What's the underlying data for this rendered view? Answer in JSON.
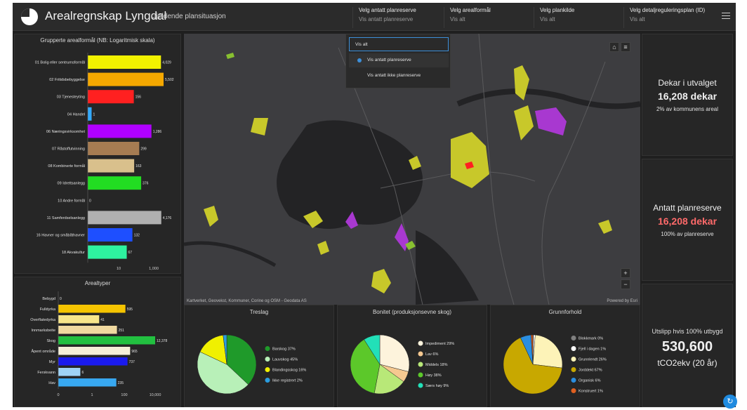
{
  "header": {
    "title": "Arealregnskap Lyngdal",
    "subtitle": "Gjeldende plansituasjon",
    "filters": [
      {
        "label": "Velg antatt planreserve",
        "value": "Vis antatt planreserve"
      },
      {
        "label": "Velg arealformål",
        "value": "Vis alt"
      },
      {
        "label": "Velg plankilde",
        "value": "Vis alt"
      },
      {
        "label": "Velg detaljreguleringsplan (ID)",
        "value": "Vis alt"
      }
    ]
  },
  "dropdown": {
    "options": [
      "Vis alt",
      "Vis antatt planreserve",
      "Vis antatt ikke planreserve"
    ]
  },
  "map": {
    "credit": "Kartverket, Geovekst, Kommuner, Corine og OSM - Geodata AS",
    "powered": "Powered by Esri",
    "zoom_in": "+",
    "zoom_out": "−"
  },
  "stats": [
    {
      "title": "Dekar i utvalget",
      "value": "16,208 dekar",
      "note": "2% av kommunens areal"
    },
    {
      "title": "Antatt planreserve",
      "value": "16,208 dekar",
      "note": "100% av planreserve"
    },
    {
      "title": "Utslipp hvis 100% utbygd",
      "value": "530,600",
      "note": "tCO2ekv (20 år)"
    }
  ],
  "chart_data": [
    {
      "type": "bar",
      "title": "Grupperte arealformål (NB: Logaritmisk skala)",
      "scale": "log",
      "xticks": [
        "10",
        "1,000"
      ],
      "categories": [
        "01 Bolig eller sentrumsformål",
        "02 Fritidsbebyggelse",
        "03 Tjenesteyting",
        "04 Handel",
        "06 Næringsvirksomhet",
        "07 Råstoffutvinning",
        "08 Kombinerte formål",
        "09 Idrettsanlegg",
        "10 Andre formål",
        "11 Samferdselsanlegg",
        "16 Havner og småbåthavner",
        "18 Akvakultur"
      ],
      "values": [
        4029,
        5502,
        156,
        1,
        1286,
        299,
        163,
        376,
        0,
        4176,
        132,
        67
      ],
      "labels": [
        "4,029",
        "5,502",
        "156",
        "1",
        "1,286",
        "299",
        "163",
        "376",
        "0",
        "4,176",
        "132",
        "67"
      ],
      "colors": [
        "#f2f200",
        "#f5a800",
        "#ff2020",
        "#33aaff",
        "#b000ff",
        "#a67c52",
        "#d9c08c",
        "#22dd22",
        "#cccccc",
        "#b0b0b0",
        "#1e4fff",
        "#2ef2a0"
      ]
    },
    {
      "type": "bar",
      "title": "Arealtyper",
      "scale": "log",
      "xticks": [
        "0",
        "1",
        "100",
        "10,000"
      ],
      "categories": [
        "Bebygd",
        "Fulldyrka",
        "Overflatedyrka",
        "Innmarksbeite",
        "Skog",
        "Åpent område",
        "Myr",
        "Ferskvann",
        "Hav"
      ],
      "values": [
        0,
        595,
        41,
        251,
        12378,
        965,
        737,
        6,
        235
      ],
      "labels": [
        "0",
        "595",
        "41",
        "251",
        "12,378",
        "965",
        "737",
        "6",
        "235"
      ],
      "colors": [
        "#cccccc",
        "#f5c400",
        "#f7e58a",
        "#f0d9a0",
        "#22c040",
        "#f5efd8",
        "#1a1aee",
        "#9fd3f5",
        "#38a8f0"
      ]
    },
    {
      "type": "pie",
      "title": "Treslag",
      "labels": [
        "Barskog 37%",
        "Lauvskog 45%",
        "Blandingsskog 16%",
        "Ikke registrert 2%"
      ],
      "values": [
        37,
        45,
        16,
        2
      ],
      "colors": [
        "#1f9a2a",
        "#b8f0b8",
        "#f0f000",
        "#2a9de0"
      ]
    },
    {
      "type": "pie",
      "title": "Bonitet (produksjonsevne skog)",
      "labels": [
        "Impediment 29%",
        "Lav 6%",
        "Middels 18%",
        "Høy 38%",
        "Særs høy 9%"
      ],
      "values": [
        29,
        6,
        18,
        38,
        9
      ],
      "colors": [
        "#fdf3dc",
        "#f5c890",
        "#b8e878",
        "#5cc82a",
        "#22e0b8"
      ]
    },
    {
      "type": "pie",
      "title": "Grunnforhold",
      "labels": [
        "Blokkmark 0%",
        "Fjell i dagen 1%",
        "Grunnlendt 26%",
        "Jorddekt 67%",
        "Organisk 6%",
        "Konstruert 1%"
      ],
      "values": [
        0.3,
        1,
        26,
        67,
        6,
        1
      ],
      "colors": [
        "#808080",
        "#ffffff",
        "#fdf3b8",
        "#c8a800",
        "#2a8ee0",
        "#e06020"
      ]
    }
  ]
}
